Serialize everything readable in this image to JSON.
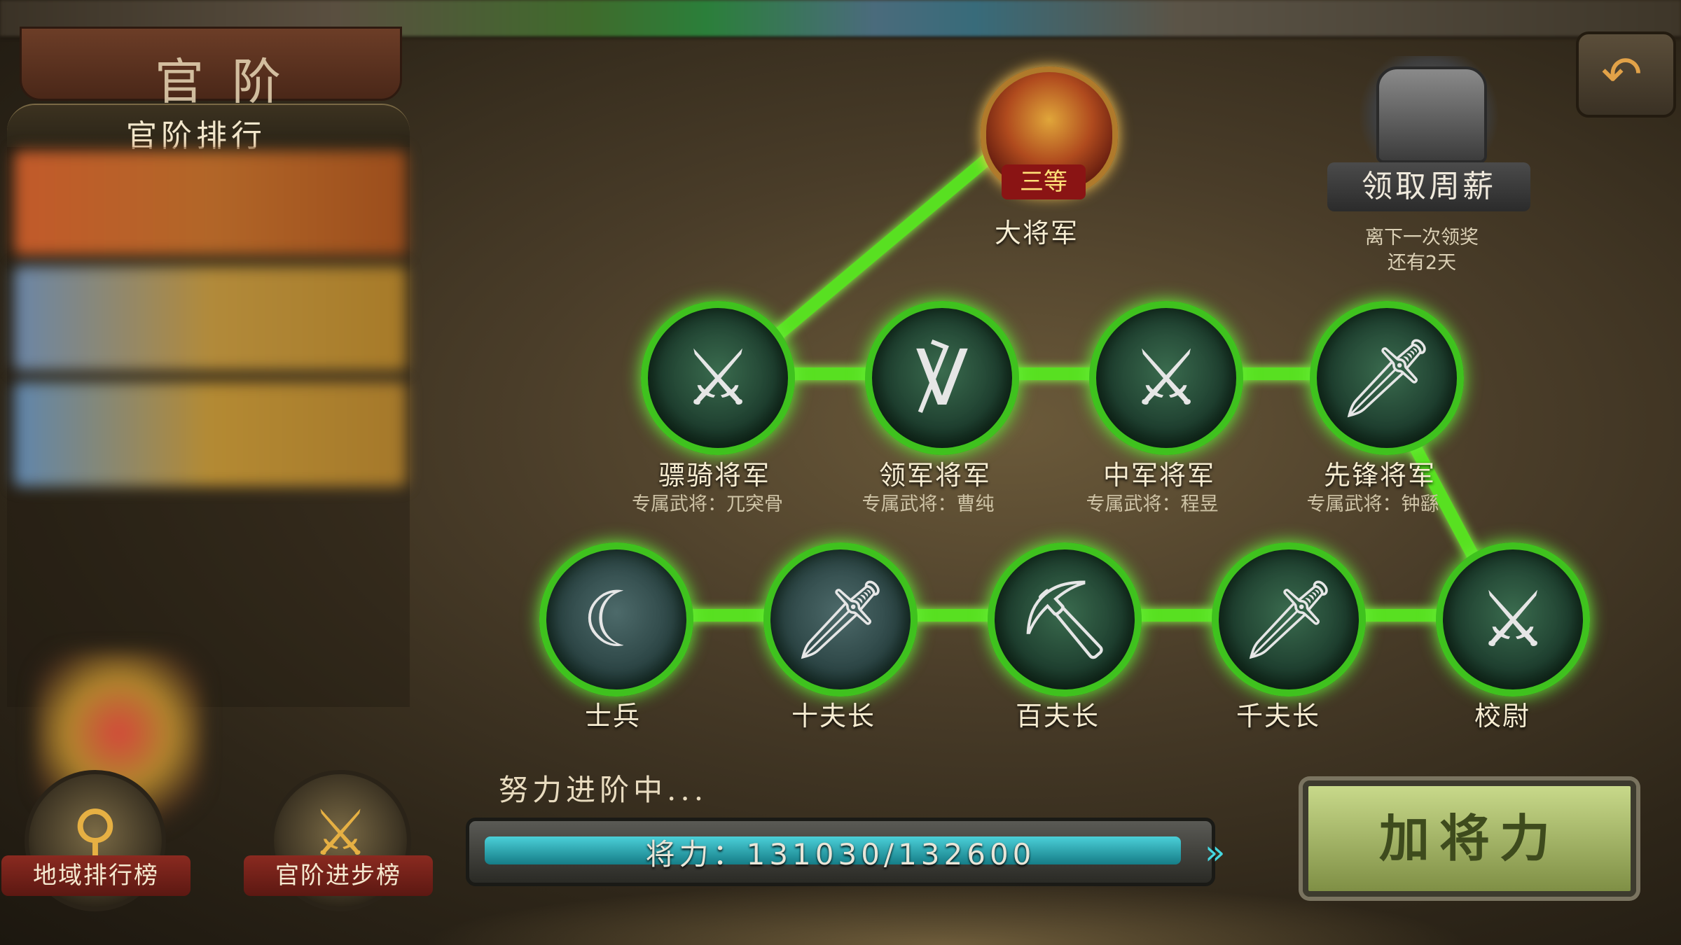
{
  "header": {
    "title": "官阶",
    "rank_panel_title": "官阶排行"
  },
  "top_rank": {
    "label": "大将军",
    "tier": "三等"
  },
  "weekly": {
    "button_label": "领取周薪",
    "note_line1": "离下一次领奖",
    "note_line2": "还有2天"
  },
  "middle_ranks": [
    {
      "label": "骠骑将军",
      "sub": "专属武将：兀突骨"
    },
    {
      "label": "领军将军",
      "sub": "专属武将：曹纯"
    },
    {
      "label": "中军将军",
      "sub": "专属武将：程昱"
    },
    {
      "label": "先锋将军",
      "sub": "专属武将：钟繇"
    }
  ],
  "lower_ranks": [
    {
      "label": "士兵"
    },
    {
      "label": "十夫长"
    },
    {
      "label": "百夫长"
    },
    {
      "label": "千夫长"
    },
    {
      "label": "校尉"
    }
  ],
  "progress": {
    "caption": "努力进阶中...",
    "text": "将力：131030/132600",
    "fraction": 0.988
  },
  "actions": {
    "add_power": "加将力"
  },
  "bottom_buttons": {
    "region_rank": "地域排行榜",
    "promotion_rank": "官阶进步榜"
  },
  "icons": {
    "back": "back-arrow-icon",
    "chest": "treasure-chest-icon",
    "region": "map-pin-icon",
    "promotion": "crossed-swords-arrow-icon"
  },
  "colors": {
    "path_green": "#58e021",
    "progress_teal": "#2ab3bd",
    "button_green": "#a9bb68"
  }
}
